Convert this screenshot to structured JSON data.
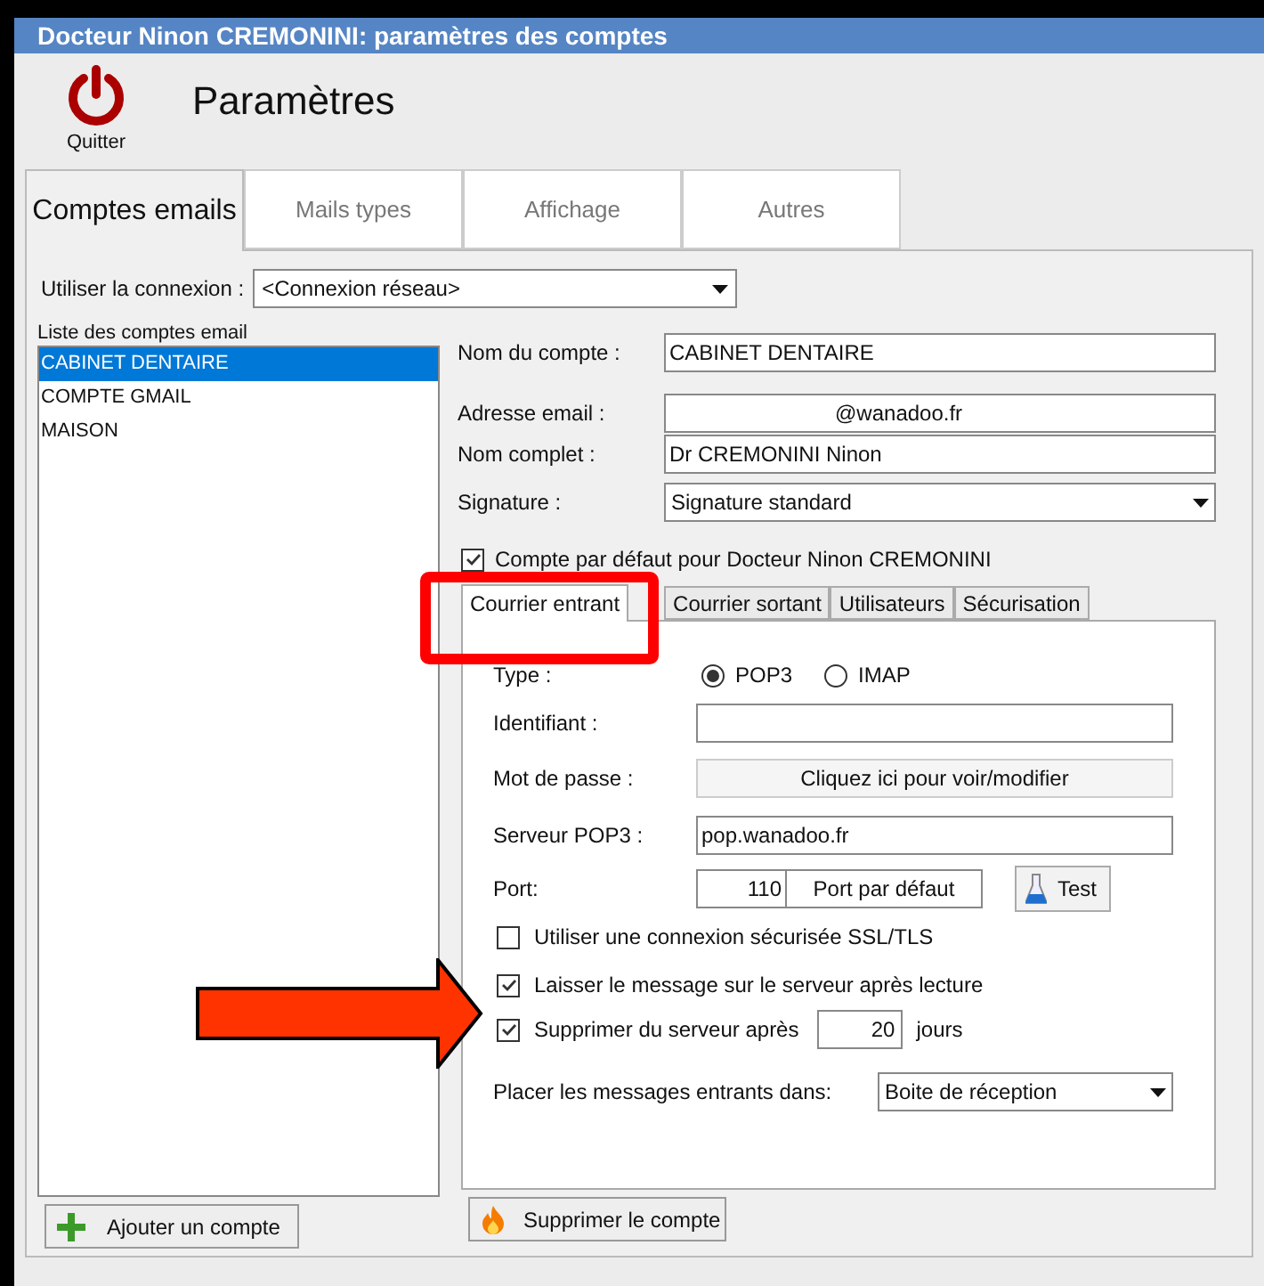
{
  "window": {
    "title": "Docteur Ninon CREMONINI: paramètres des comptes"
  },
  "header": {
    "quit_label": "Quitter",
    "title": "Paramètres"
  },
  "tabs": [
    {
      "label": "Comptes emails",
      "selected": true
    },
    {
      "label": "Mails types",
      "selected": false
    },
    {
      "label": "Affichage",
      "selected": false
    },
    {
      "label": "Autres",
      "selected": false
    }
  ],
  "connection": {
    "label": "Utiliser la connexion :",
    "value": "<Connexion réseau>"
  },
  "accounts": {
    "label": "Liste des comptes email",
    "items": [
      {
        "label": "CABINET DENTAIRE",
        "selected": true
      },
      {
        "label": "COMPTE GMAIL",
        "selected": false
      },
      {
        "label": "MAISON",
        "selected": false
      }
    ],
    "add_button": "Ajouter un compte"
  },
  "account_form": {
    "fields": [
      {
        "label": "Nom du compte :",
        "value": "CABINET DENTAIRE",
        "kind": "text"
      },
      {
        "label": "Adresse email :",
        "value": "@wanadoo.fr",
        "kind": "text"
      },
      {
        "label": "Nom complet :",
        "value": "Dr CREMONINI Ninon",
        "kind": "text"
      },
      {
        "label": "Signature :",
        "value": "Signature standard",
        "kind": "select"
      }
    ],
    "default_checkbox": {
      "label": "Compte par défaut pour Docteur Ninon CREMONINI",
      "checked": true
    }
  },
  "inner_tabs": [
    {
      "label": "Courrier entrant",
      "selected": true
    },
    {
      "label": "Courrier sortant",
      "selected": false
    },
    {
      "label": "Utilisateurs",
      "selected": false
    },
    {
      "label": "Sécurisation",
      "selected": false
    }
  ],
  "incoming": {
    "type_label": "Type :",
    "type_options": [
      {
        "label": "POP3",
        "selected": true
      },
      {
        "label": "IMAP",
        "selected": false
      }
    ],
    "login_label": "Identifiant :",
    "password": {
      "label": "Mot de passe :",
      "button": "Cliquez ici pour voir/modifier"
    },
    "server": {
      "label": "Serveur POP3 :",
      "value": "pop.wanadoo.fr"
    },
    "port": {
      "label": "Port:",
      "value": "110",
      "default_button": "Port par défaut",
      "test_button": "Test"
    },
    "options": [
      {
        "label": "Utiliser une connexion sécurisée SSL/TLS",
        "checked": false
      },
      {
        "label": "Laisser le message sur le serveur après lecture",
        "checked": true
      }
    ],
    "delete_after": {
      "label": "Supprimer du serveur après",
      "checked": true,
      "value": "20",
      "unit": "jours"
    },
    "destination": {
      "label": "Placer les messages entrants dans:",
      "value": "Boite de réception"
    }
  },
  "delete_button": "Supprimer le compte"
}
